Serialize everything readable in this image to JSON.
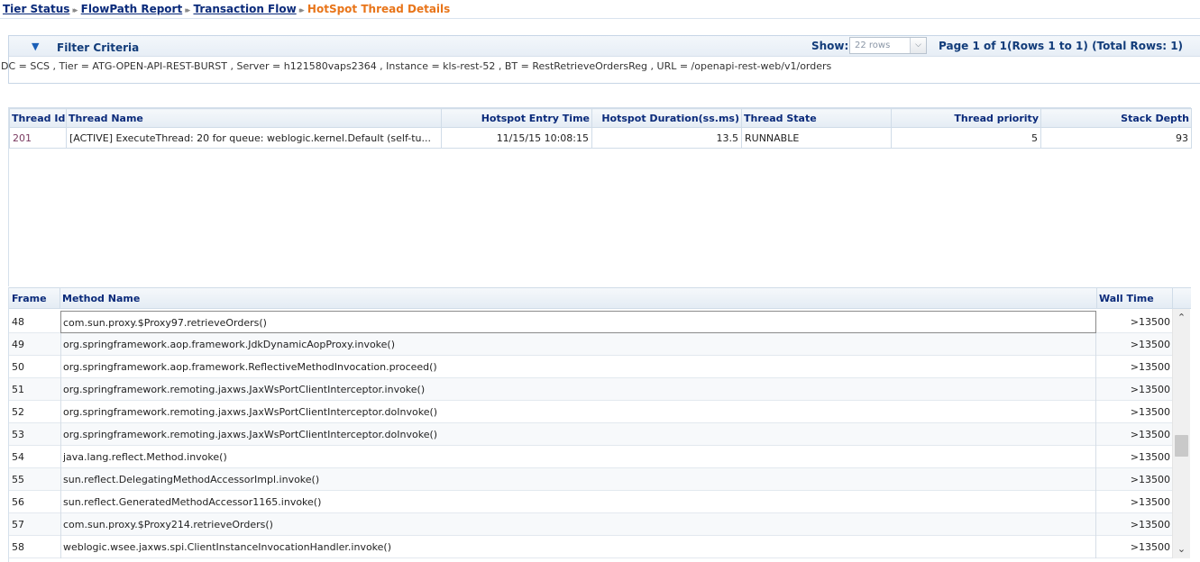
{
  "breadcrumb": {
    "items": [
      "Tier Status",
      "FlowPath Report",
      "Transaction Flow"
    ],
    "current": "HotSpot Thread Details",
    "separator": "▸▸"
  },
  "filter": {
    "title": "Filter Criteria",
    "toggle_icon": "▼",
    "show_label": "Show:",
    "rows_selected": "22 rows",
    "dropdown_icon": "⌵",
    "page_info": "Page 1 of 1(Rows 1 to 1) (Total Rows: 1)",
    "criteria": "DC = SCS , Tier = ATG-OPEN-API-REST-BURST , Server = h121580vaps2364 , Instance = kls-rest-52 , BT = RestRetrieveOrdersReg , URL = /openapi-rest-web/v1/orders"
  },
  "thread_table": {
    "headers": {
      "thread_id": "Thread Id",
      "thread_name": "Thread Name",
      "entry_time": "Hotspot Entry Time",
      "duration": "Hotspot Duration(ss.ms)",
      "state": "Thread State",
      "priority": "Thread priority",
      "stack_depth": "Stack Depth"
    },
    "row": {
      "thread_id": "201",
      "thread_name": "[ACTIVE] ExecuteThread: 20 for queue: weblogic.kernel.Default (self-tu...",
      "entry_time": "11/15/15 10:08:15",
      "duration": "13.5",
      "state": "RUNNABLE",
      "priority": "5",
      "stack_depth": "93"
    }
  },
  "method_table": {
    "headers": {
      "frame": "Frame",
      "method": "Method Name",
      "wall": "Wall Time"
    },
    "rows": [
      {
        "frame": "48",
        "method": "com.sun.proxy.$Proxy97.retrieveOrders()",
        "wall": ">13500"
      },
      {
        "frame": "49",
        "method": "org.springframework.aop.framework.JdkDynamicAopProxy.invoke()",
        "wall": ">13500"
      },
      {
        "frame": "50",
        "method": "org.springframework.aop.framework.ReflectiveMethodInvocation.proceed()",
        "wall": ">13500"
      },
      {
        "frame": "51",
        "method": "org.springframework.remoting.jaxws.JaxWsPortClientInterceptor.invoke()",
        "wall": ">13500"
      },
      {
        "frame": "52",
        "method": "org.springframework.remoting.jaxws.JaxWsPortClientInterceptor.doInvoke()",
        "wall": ">13500"
      },
      {
        "frame": "53",
        "method": "org.springframework.remoting.jaxws.JaxWsPortClientInterceptor.doInvoke()",
        "wall": ">13500"
      },
      {
        "frame": "54",
        "method": "java.lang.reflect.Method.invoke()",
        "wall": ">13500"
      },
      {
        "frame": "55",
        "method": "sun.reflect.DelegatingMethodAccessorImpl.invoke()",
        "wall": ">13500"
      },
      {
        "frame": "56",
        "method": "sun.reflect.GeneratedMethodAccessor1165.invoke()",
        "wall": ">13500"
      },
      {
        "frame": "57",
        "method": "com.sun.proxy.$Proxy214.retrieveOrders()",
        "wall": ">13500"
      },
      {
        "frame": "58",
        "method": "weblogic.wsee.jaxws.spi.ClientInstanceInvocationHandler.invoke()",
        "wall": ">13500"
      }
    ]
  },
  "scrollbar": {
    "up_icon": "⌃",
    "down_icon": "⌄"
  }
}
